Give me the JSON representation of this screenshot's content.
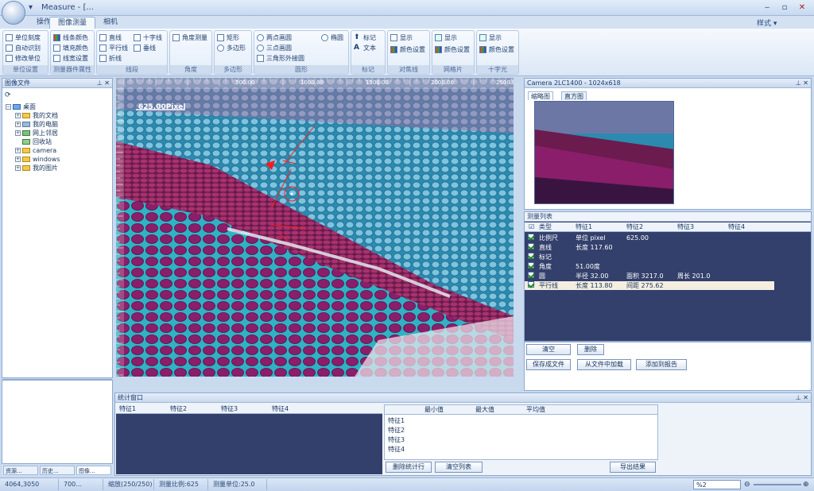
{
  "window": {
    "title": "Measure - [...",
    "quick_access": "▾"
  },
  "tabs": [
    "操作",
    "图像测量",
    "相机"
  ],
  "style_label": "样式 ▾",
  "ribbon": {
    "groups": [
      {
        "label": "单位设置",
        "items": [
          "单位刻度",
          "自动识别",
          "修改单位"
        ]
      },
      {
        "label": "测量器件属性",
        "items": [
          "线条颜色",
          "填充颜色",
          "线宽设置"
        ]
      },
      {
        "label": "线段",
        "items": [
          "直线",
          "十字线",
          "平行线",
          "垂线",
          "折线"
        ]
      },
      {
        "label": "角度",
        "items": [
          "角度测量"
        ]
      },
      {
        "label": "多边形",
        "items": [
          "矩形",
          "多边形"
        ]
      },
      {
        "label": "圆形",
        "items": [
          "两点画圆",
          "三点画圆",
          "三角形外接圆",
          "椭圆"
        ]
      },
      {
        "label": "标记",
        "items": [
          "标记",
          "文本"
        ]
      },
      {
        "label": "对焦线",
        "items": [
          "显示",
          "颜色设置"
        ]
      },
      {
        "label": "网格片",
        "items": [
          "显示",
          "颜色设置"
        ]
      },
      {
        "label": "十字光",
        "items": [
          "显示",
          "颜色设置"
        ]
      }
    ]
  },
  "file_panel": {
    "title": "图像文件",
    "tree": [
      "桌面",
      "我的文档",
      "我的电脑",
      "网上邻居",
      "回收站",
      "camera",
      "windows",
      "我的图片"
    ]
  },
  "left_tabs": [
    "资源...",
    "历史...",
    "图像..."
  ],
  "image": {
    "scale_label": "625.00Pixel",
    "ruler_labels": [
      "500.00",
      "1000.00",
      "1500.00",
      "2000.00",
      "2500.00"
    ]
  },
  "preview_panel": {
    "title": "Camera 2LC1400 - 1024x618",
    "tabs": [
      "缩略图",
      "直方图"
    ]
  },
  "measure_panel": {
    "title": "测量列表",
    "headers": [
      "类型",
      "特征1",
      "特征2",
      "特征3",
      "特征4"
    ],
    "rows": [
      {
        "type": "比例尺",
        "f1": "单位 pixel",
        "f2": "625.00",
        "f3": ""
      },
      {
        "type": "直线",
        "f1": "长度 117.60",
        "f2": "",
        "f3": ""
      },
      {
        "type": "标记",
        "f1": "",
        "f2": "",
        "f3": ""
      },
      {
        "type": "角度",
        "f1": "51.00度",
        "f2": "",
        "f3": ""
      },
      {
        "type": "圆",
        "f1": "半径 32.00",
        "f2": "面积 3217.0",
        "f3": "周长 201.0"
      },
      {
        "type": "平行线",
        "f1": "长度 113.80",
        "f2": "间距 275.62",
        "f3": ""
      }
    ],
    "buttons": [
      "清空",
      "删除",
      "保存成文件",
      "从文件中加载",
      "添加到报告"
    ]
  },
  "stats_panel": {
    "title": "统计窗口",
    "left_headers": [
      "特征1",
      "特征2",
      "特征3",
      "特征4"
    ],
    "right_headers": [
      "最小值",
      "最大值",
      "平均值"
    ],
    "right_rows": [
      "特征1",
      "特征2",
      "特征3",
      "特征4"
    ],
    "buttons": [
      "删除统计行",
      "清空列表",
      "导出结果"
    ]
  },
  "status": [
    "4064,3050",
    "700...",
    "缩放(250/250)",
    "测量比例:625",
    "测量单位:25.0"
  ],
  "zoom": "%2"
}
